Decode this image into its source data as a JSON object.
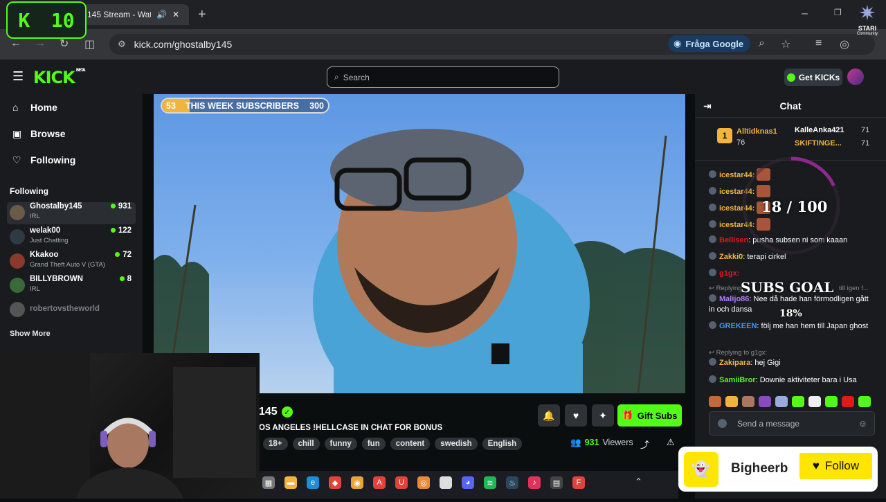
{
  "browser": {
    "tab_title": "145 Stream - Wat",
    "url": "kick.com/ghostalby145",
    "ask_google": "Fråga Google"
  },
  "overlay": {
    "k_counter_letter": "K",
    "k_counter_value": "10",
    "brand_name": "STARI",
    "brand_sub": "Community"
  },
  "kick": {
    "logo": "KICK",
    "logo_badge": "BETA",
    "search_placeholder": "Search",
    "get_kicks": "Get KICKs"
  },
  "sidebar": {
    "nav": [
      {
        "label": "Home",
        "icon": "home-icon"
      },
      {
        "label": "Browse",
        "icon": "browse-icon"
      },
      {
        "label": "Following",
        "icon": "heart-icon"
      }
    ],
    "following_header": "Following",
    "following": [
      {
        "name": "Ghostalby145",
        "category": "IRL",
        "viewers": "931",
        "color": "#6b5a4a"
      },
      {
        "name": "welak00",
        "category": "Just Chatting",
        "viewers": "122",
        "color": "#2e3a44"
      },
      {
        "name": "Kkakoo",
        "category": "Grand Theft Auto V (GTA)",
        "viewers": "72",
        "color": "#8a3a2a"
      },
      {
        "name": "BILLYBROWN",
        "category": "IRL",
        "viewers": "8",
        "color": "#3a6a3a"
      },
      {
        "name": "robertovstheworld",
        "category": "",
        "viewers": "",
        "color": "#555"
      }
    ],
    "show_more": "Show More"
  },
  "stream": {
    "subs_start": "53",
    "subs_label": "THIS WEEK SUBSCRIBERS",
    "subs_target": "300",
    "subs_progress": 0.18,
    "name": "145",
    "title": "OS ANGELES !HELLCASE IN CHAT FOR BONUS",
    "tags": [
      "18+",
      "chill",
      "funny",
      "fun",
      "content",
      "swedish",
      "English"
    ],
    "viewers": "931",
    "viewers_label": "Viewers",
    "gift_subs": "Gift Subs"
  },
  "chat": {
    "header": "Chat",
    "podium": [
      {
        "rank": "1",
        "name": "Alltidknas1",
        "count": "76"
      },
      {
        "name": "KalleAnka421",
        "count": "71"
      },
      {
        "name": "SKIFTINGE...",
        "count": "71"
      }
    ],
    "goal_progress_text": "18 / 100",
    "subs_goal": "SUBS GOAL",
    "subs_goal_pct": "18%",
    "messages": [
      {
        "user": "icestar44:",
        "text": "",
        "color": "#f2b43c",
        "emote": true
      },
      {
        "user": "icestar44:",
        "text": "",
        "color": "#f2b43c",
        "emote": true
      },
      {
        "user": "icestar44:",
        "text": "",
        "color": "#f2b43c",
        "emote": true
      },
      {
        "user": "icestar44:",
        "text": "",
        "color": "#f2b43c",
        "emote": true
      },
      {
        "user": "Bellisen",
        "text": ": pusha subsen ni som kaaan",
        "color": "#e01919",
        "emote": false
      },
      {
        "user": "Zakki0",
        "text": ": terapi cirkel",
        "color": "#f2b43c",
        "emote": false
      },
      {
        "user": "g1gx:",
        "text": "",
        "color": "#e01919",
        "emote": false
      },
      {
        "user": "Malijo86",
        "text": ": Nee då hade han förmodligen gått in och dansa",
        "color": "#b07cff",
        "emote": false
      },
      {
        "user": "GREKEEN",
        "text": ": följ me han hem till Japan ghost",
        "color": "#3c9bff",
        "emote": false
      },
      {
        "user": "Zakipara",
        "text": ": hej Gigi",
        "color": "#f2b43c",
        "emote": false
      },
      {
        "user": "SamiiBror",
        "text": ": Downie aktiviteter bara i Usa",
        "color": "#53fc18",
        "emote": false
      }
    ],
    "reply_1": "Replying",
    "reply_1_tail": "till igen f...",
    "reply_2": "Replying to g1gx:",
    "send_placeholder": "Send a message"
  },
  "follow_overlay": {
    "name": "Bigheerb",
    "button": "Follow"
  }
}
